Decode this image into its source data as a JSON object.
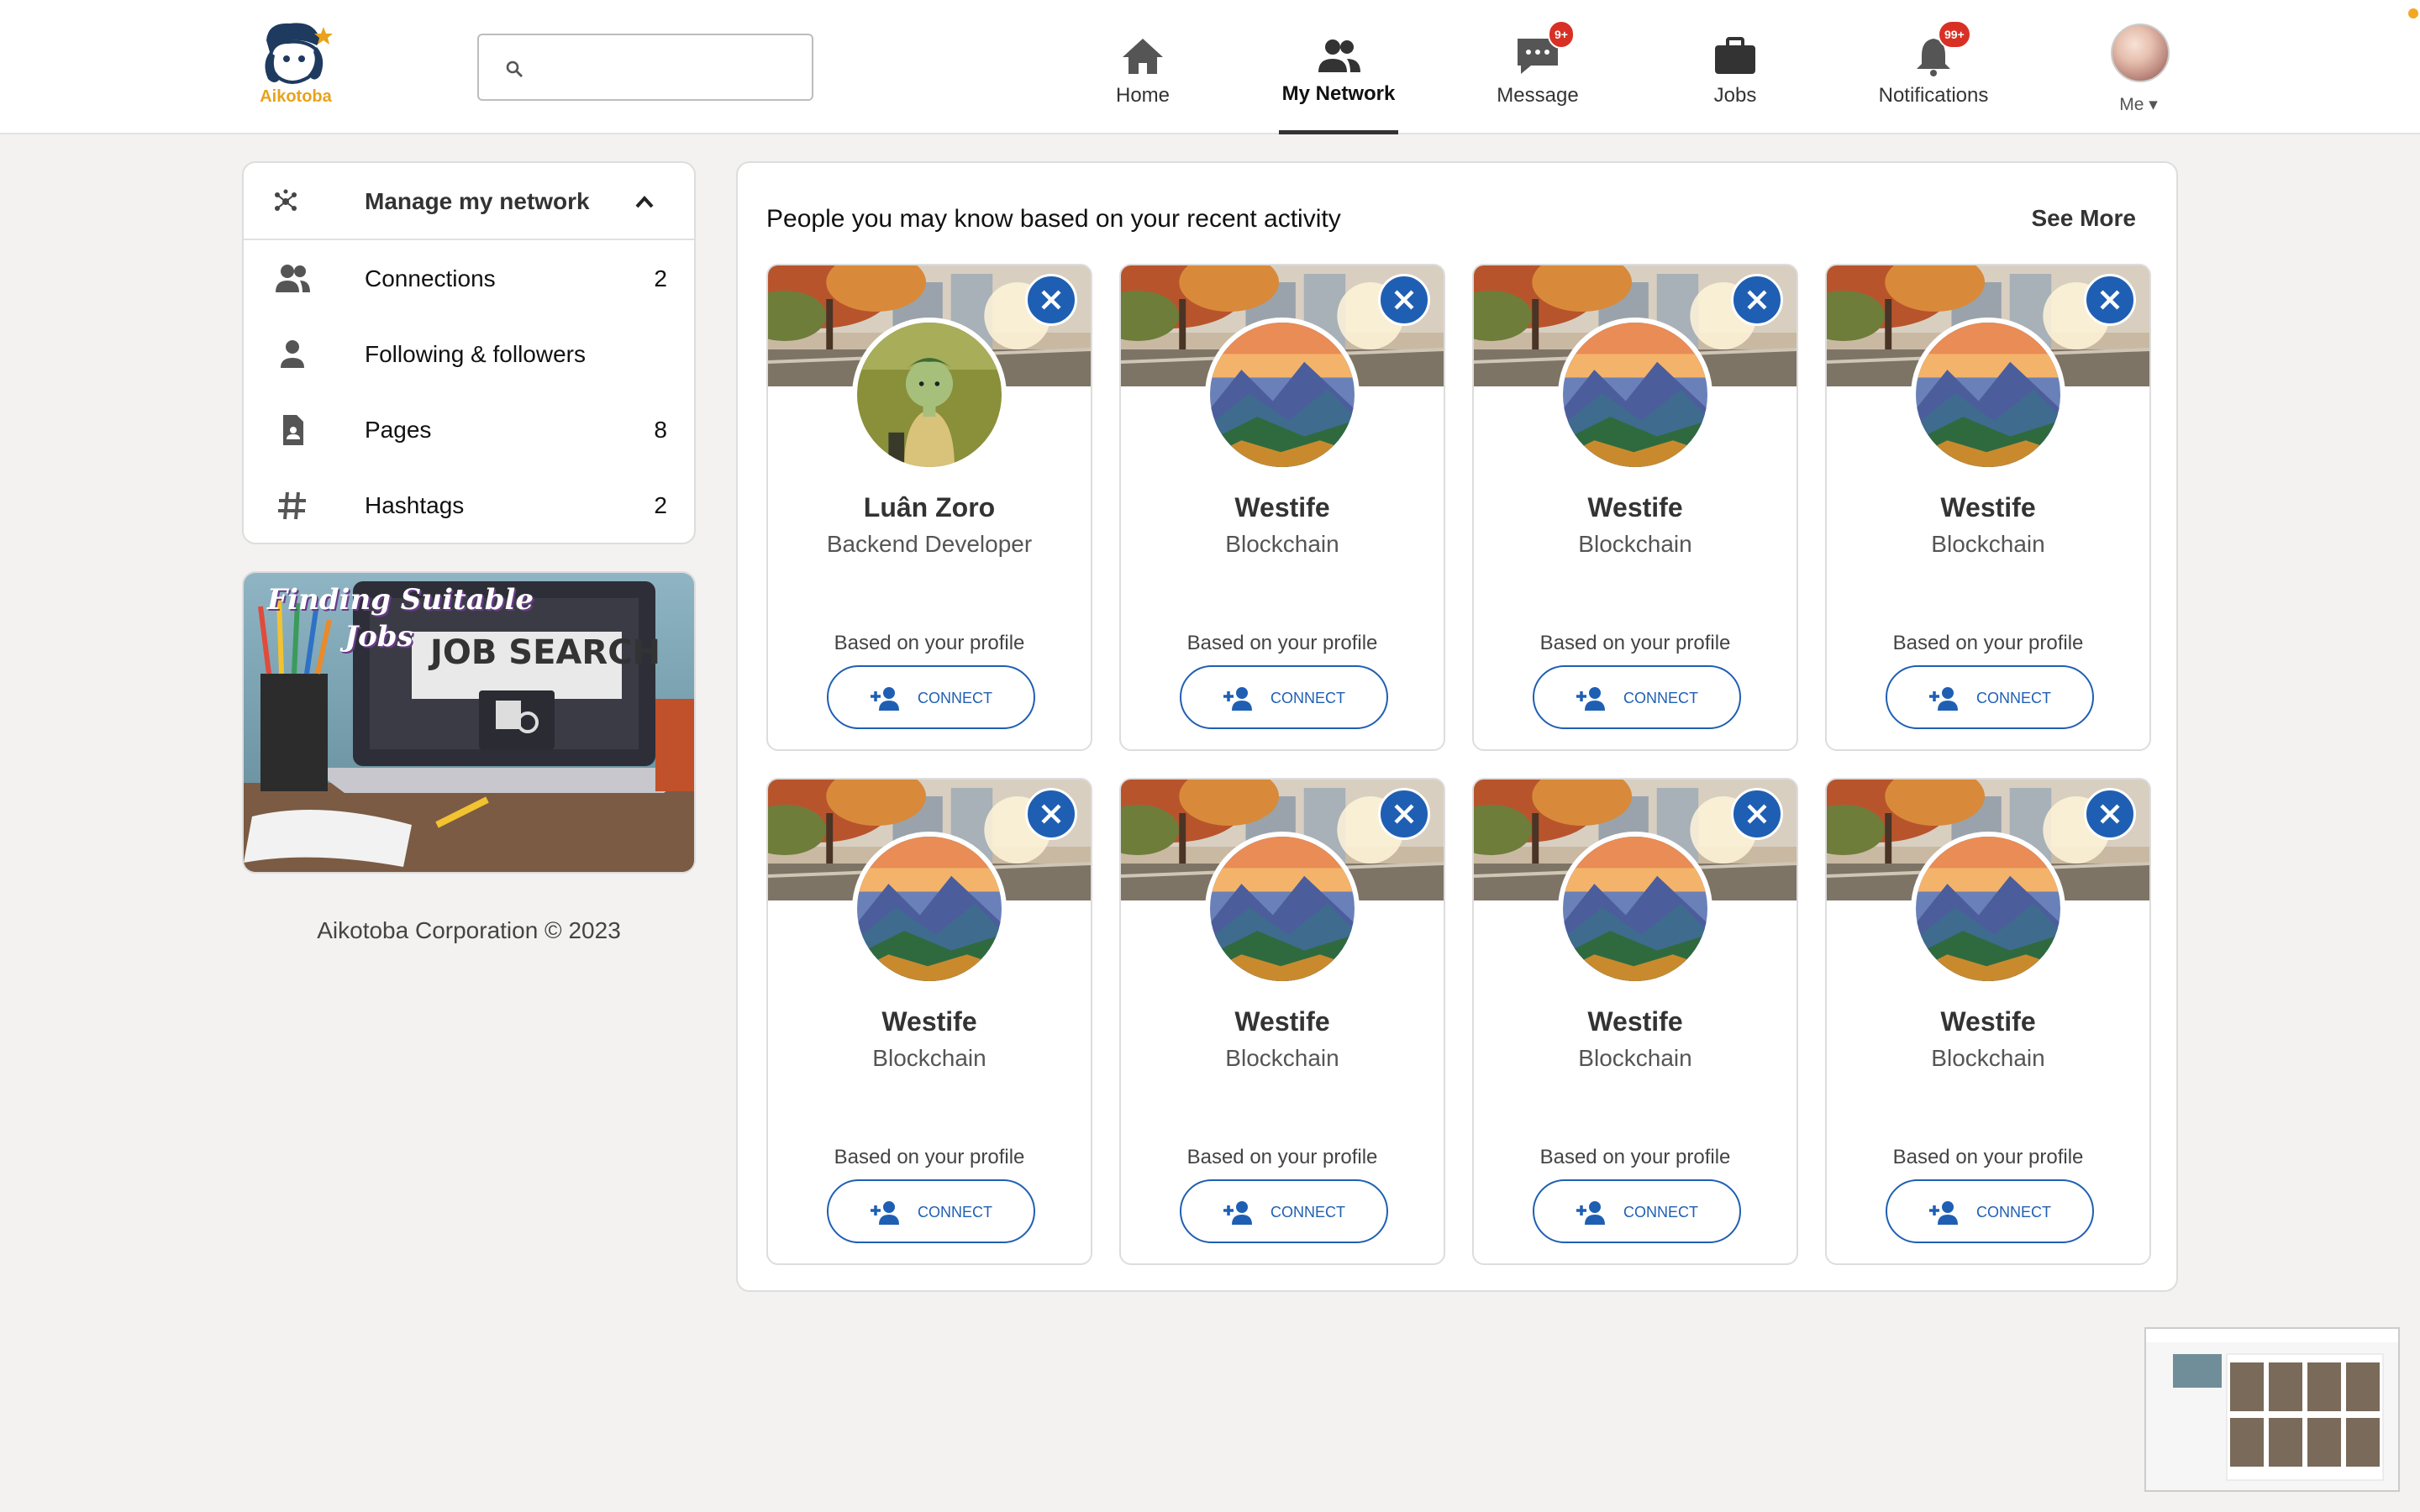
{
  "brand": {
    "name": "Aikotoba",
    "color": "#e8a21c"
  },
  "search": {
    "value": "",
    "placeholder": ""
  },
  "nav": {
    "home": "Home",
    "network": "My Network",
    "message": "Message",
    "message_badge": "9+",
    "jobs": "Jobs",
    "notifications": "Notifications",
    "notifications_badge": "99+",
    "me": "Me"
  },
  "sidebar": {
    "title": "Manage my network",
    "items": [
      {
        "label": "Connections",
        "count": "2",
        "icon": "people-icon"
      },
      {
        "label": "Following & followers",
        "count": "",
        "icon": "person-icon"
      },
      {
        "label": "Pages",
        "count": "8",
        "icon": "page-icon"
      },
      {
        "label": "Hashtags",
        "count": "2",
        "icon": "hashtag-icon"
      }
    ],
    "banner": {
      "line1": "Finding Suitable",
      "line2": "Jobs",
      "screen": "JOB SEARCH"
    },
    "copyright": "Aikotoba Corporation © 2023"
  },
  "main": {
    "title": "People you may know based on your recent activity",
    "see_more": "See More",
    "cards": [
      {
        "name": "Luân Zoro",
        "role": "Backend Developer",
        "reason": "Based on your profile",
        "button": "CONNECT"
      },
      {
        "name": "Westife",
        "role": "Blockchain",
        "reason": "Based on your profile",
        "button": "CONNECT"
      },
      {
        "name": "Westife",
        "role": "Blockchain",
        "reason": "Based on your profile",
        "button": "CONNECT"
      },
      {
        "name": "Westife",
        "role": "Blockchain",
        "reason": "Based on your profile",
        "button": "CONNECT"
      },
      {
        "name": "Westife",
        "role": "Blockchain",
        "reason": "Based on your profile",
        "button": "CONNECT"
      },
      {
        "name": "Westife",
        "role": "Blockchain",
        "reason": "Based on your profile",
        "button": "CONNECT"
      },
      {
        "name": "Westife",
        "role": "Blockchain",
        "reason": "Based on your profile",
        "button": "CONNECT"
      },
      {
        "name": "Westife",
        "role": "Blockchain",
        "reason": "Based on your profile",
        "button": "CONNECT"
      }
    ]
  },
  "colors": {
    "accent": "#1f5fb3",
    "badge": "#d93025",
    "background": "#f3f2f0"
  }
}
